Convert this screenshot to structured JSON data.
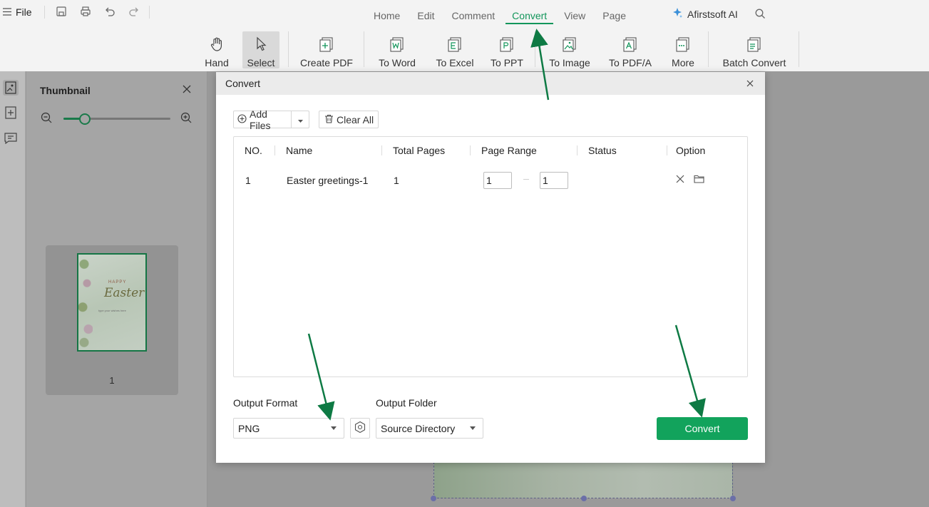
{
  "app": {
    "menu": {
      "file_label": "File"
    },
    "nav": [
      {
        "label": "Home"
      },
      {
        "label": "Edit"
      },
      {
        "label": "Comment"
      },
      {
        "label": "Convert"
      },
      {
        "label": "View"
      },
      {
        "label": "Page"
      }
    ],
    "active_tab": "Convert",
    "ai_label": "Afirstsoft AI",
    "toolbar": {
      "hand": "Hand",
      "select": "Select",
      "create_pdf": "Create PDF",
      "to_word": "To Word",
      "to_excel": "To Excel",
      "to_ppt": "To PPT",
      "to_image": "To Image",
      "to_pdfa": "To PDF/A",
      "more": "More",
      "batch_convert": "Batch Convert"
    }
  },
  "thumbnail_panel": {
    "title": "Thumbnail",
    "zoom_level": 0.2,
    "page_label": "1",
    "thumb_text": {
      "happy": "HAPPY",
      "easter": "Easter",
      "sub": "type your wishes here"
    }
  },
  "dialog": {
    "title": "Convert",
    "add_files_label": "Add Files",
    "clear_all_label": "Clear All",
    "columns": [
      "NO.",
      "Name",
      "Total Pages",
      "Page Range",
      "Status",
      "Option"
    ],
    "rows": [
      {
        "no": "1",
        "name": "Easter greetings-1",
        "total_pages": "1",
        "range_from": "1",
        "range_to": "1",
        "status": ""
      }
    ],
    "output_format_label": "Output Format",
    "output_format_value": "PNG",
    "output_folder_label": "Output Folder",
    "output_folder_value": "Source Directory",
    "convert_label": "Convert"
  },
  "colors": {
    "accent": "#12955a",
    "button": "#12a35c",
    "arrow": "#0e7a44"
  }
}
